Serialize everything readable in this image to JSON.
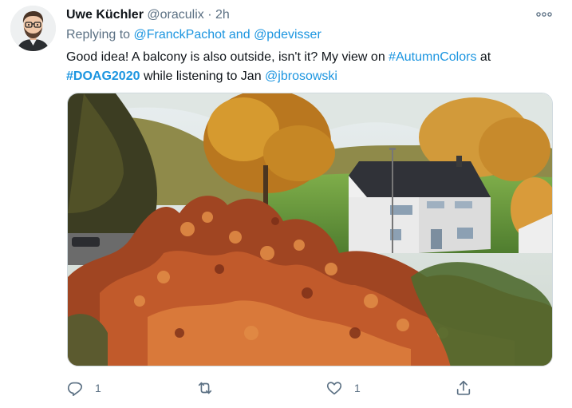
{
  "author": {
    "name": "Uwe Küchler",
    "handle": "@oraculix",
    "separator": "·",
    "time": "2h"
  },
  "reply_to": {
    "prefix": "Replying to",
    "user1": "@FranckPachot",
    "conj": "and",
    "user2": "@pdevisser"
  },
  "tweet": {
    "line1_text": "Good idea! A balcony is also outside, isn't it? My view on",
    "hashtag1": "#AutumnColors",
    "line1_end": "at",
    "hashtag2": "#DOAG2020",
    "line2_text": "while listening to Jan",
    "mention": "@jbrosowski"
  },
  "actions": {
    "reply_count": "1",
    "like_count": "1"
  },
  "icons": {
    "more": "more-dots-icon",
    "reply": "reply-bubble-icon",
    "retweet": "retweet-icon",
    "like": "heart-icon",
    "share": "share-upload-icon"
  },
  "colors": {
    "link": "#1b95e0",
    "muted": "#5b7083",
    "text": "#0f1419"
  }
}
